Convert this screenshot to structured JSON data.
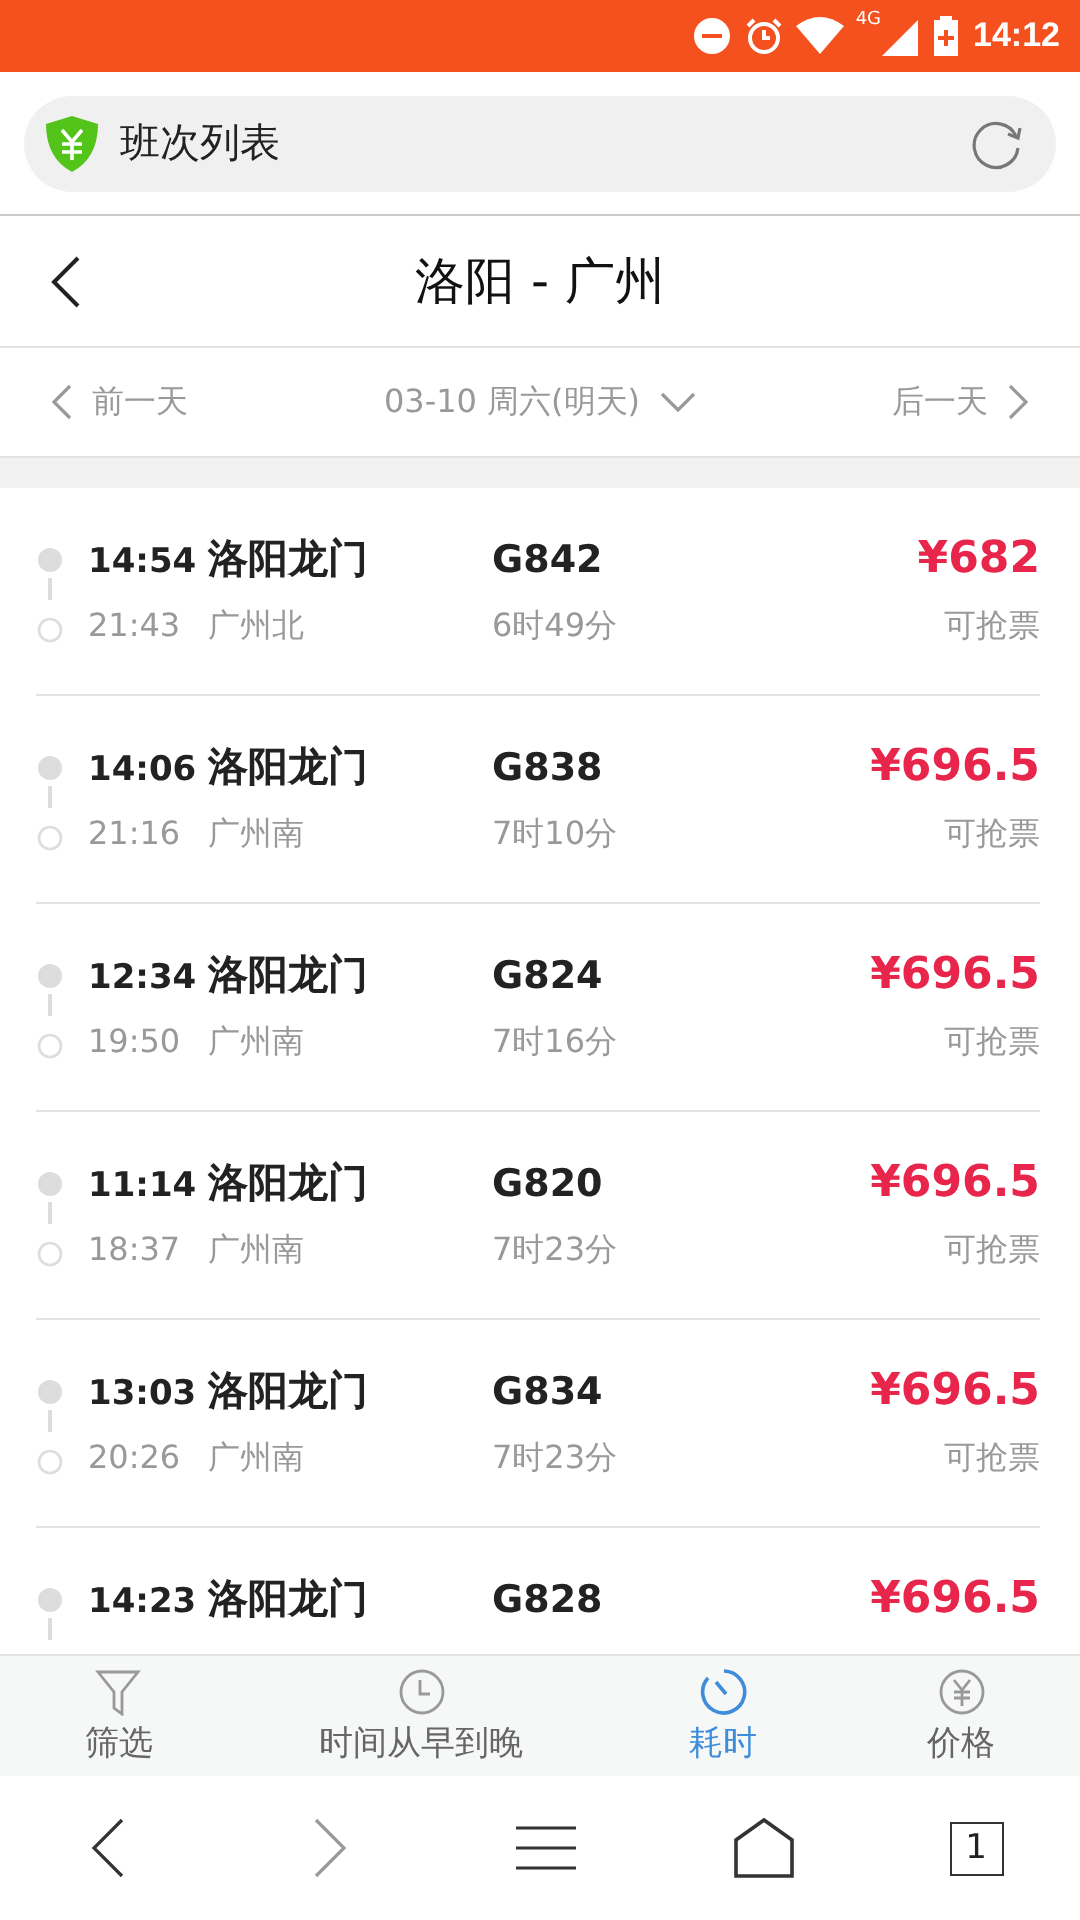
{
  "status_bar": {
    "network": "4G",
    "time": "14:12"
  },
  "browser_bar": {
    "title": "班次列表"
  },
  "header": {
    "title": "洛阳 - 广州"
  },
  "date_bar": {
    "prev": "前一天",
    "date": "03-10 周六(明天)",
    "next": "后一天"
  },
  "trains": [
    {
      "depart_time": "14:54",
      "depart_station": "洛阳龙门",
      "arrive_time": "21:43",
      "arrive_station": "广州北",
      "train_no": "G842",
      "duration": "6时49分",
      "price": "¥682",
      "status": "可抢票"
    },
    {
      "depart_time": "14:06",
      "depart_station": "洛阳龙门",
      "arrive_time": "21:16",
      "arrive_station": "广州南",
      "train_no": "G838",
      "duration": "7时10分",
      "price": "¥696.5",
      "status": "可抢票"
    },
    {
      "depart_time": "12:34",
      "depart_station": "洛阳龙门",
      "arrive_time": "19:50",
      "arrive_station": "广州南",
      "train_no": "G824",
      "duration": "7时16分",
      "price": "¥696.5",
      "status": "可抢票"
    },
    {
      "depart_time": "11:14",
      "depart_station": "洛阳龙门",
      "arrive_time": "18:37",
      "arrive_station": "广州南",
      "train_no": "G820",
      "duration": "7时23分",
      "price": "¥696.5",
      "status": "可抢票"
    },
    {
      "depart_time": "13:03",
      "depart_station": "洛阳龙门",
      "arrive_time": "20:26",
      "arrive_station": "广州南",
      "train_no": "G834",
      "duration": "7时23分",
      "price": "¥696.5",
      "status": "可抢票"
    },
    {
      "depart_time": "14:23",
      "depart_station": "洛阳龙门",
      "train_no": "G828",
      "price": "¥696.5"
    }
  ],
  "sort_bar": [
    {
      "kind": "filter",
      "label": "筛选",
      "selected": false
    },
    {
      "kind": "clock",
      "label": "时间从早到晚",
      "selected": false
    },
    {
      "kind": "timer",
      "label": "耗时",
      "selected": true
    },
    {
      "kind": "price",
      "label": "价格",
      "selected": false
    }
  ],
  "nav_bar": {
    "tab_count": "1"
  }
}
